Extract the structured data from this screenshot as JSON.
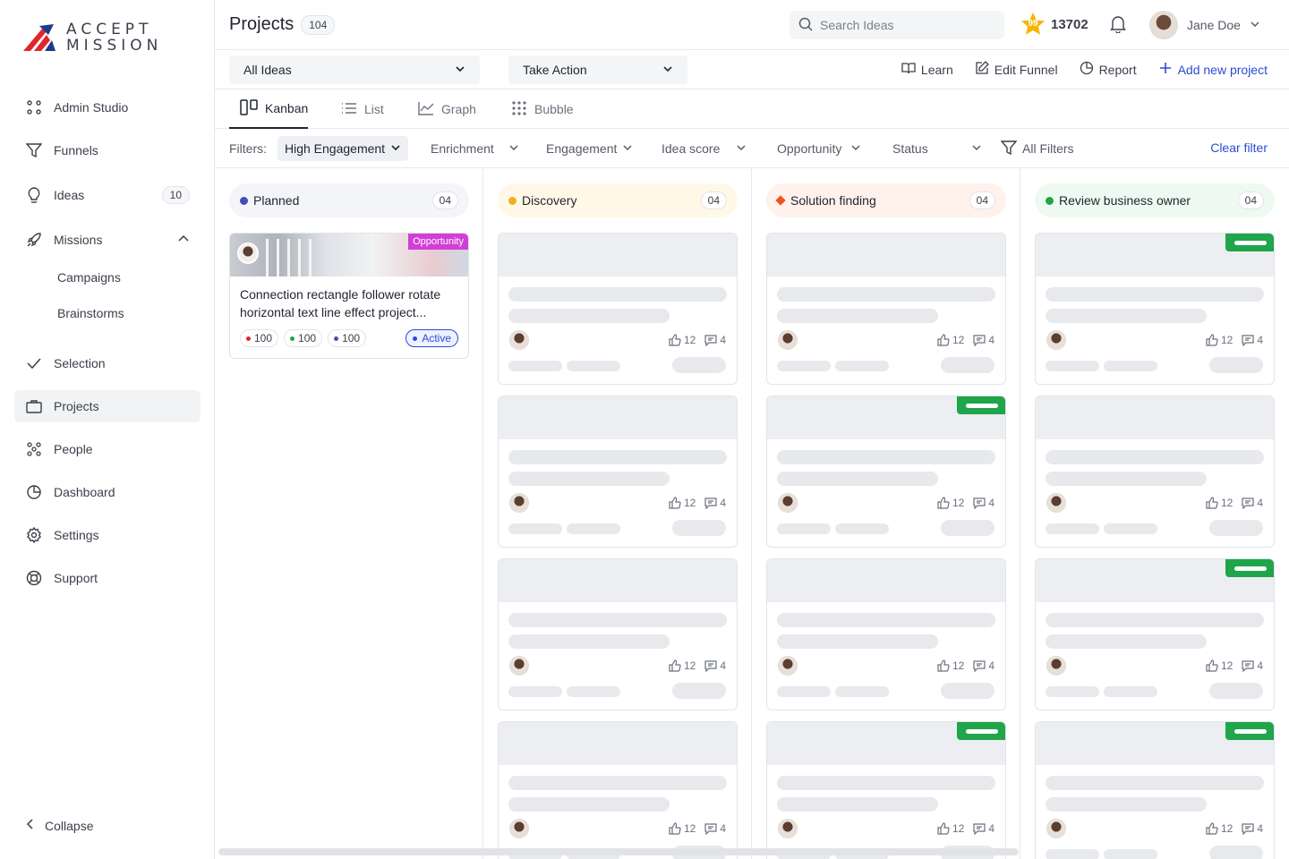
{
  "brand": {
    "line1": "ACCEPT",
    "line2": "MISSION",
    "logo_colors": [
      "#e0262d",
      "#1e3a8a"
    ]
  },
  "sidebar": {
    "items": [
      {
        "label": "Admin Studio",
        "icon": "grid-dots-icon"
      },
      {
        "label": "Funnels",
        "icon": "funnel-icon"
      },
      {
        "label": "Ideas",
        "icon": "lightbulb-icon",
        "count": "10"
      },
      {
        "label": "Missions",
        "icon": "rocket-icon"
      },
      {
        "label": "Selection",
        "icon": "check-icon"
      },
      {
        "label": "Projects",
        "icon": "briefcase-icon",
        "active": true
      },
      {
        "label": "People",
        "icon": "people-icon"
      },
      {
        "label": "Dashboard",
        "icon": "pie-chart-icon"
      },
      {
        "label": "Settings",
        "icon": "gear-icon"
      },
      {
        "label": "Support",
        "icon": "lifebuoy-icon"
      }
    ],
    "mission_sub": [
      "Campaigns",
      "Brainstorms"
    ],
    "collapse_label": "Collapse"
  },
  "header": {
    "title": "Projects",
    "count": "104",
    "search_placeholder": "Search Ideas",
    "points_badge": "99",
    "points": "13702",
    "user_name": "Jane Doe"
  },
  "actions": {
    "filter_select": "All Ideas",
    "action_select": "Take Action",
    "learn": "Learn",
    "edit_funnel": "Edit Funnel",
    "report": "Report",
    "add_project": "Add new project"
  },
  "views": {
    "kanban": "Kanban",
    "list": "List",
    "graph": "Graph",
    "bubble": "Bubble"
  },
  "filters": {
    "label": "Filters:",
    "active": "High Engagement",
    "enrichment": "Enrichment",
    "engagement": "Engagement",
    "idea_score": "Idea score",
    "opportunity": "Opportunity",
    "status": "Status",
    "all_filters": "All Filters",
    "clear": "Clear filter"
  },
  "columns": [
    {
      "name": "Planned",
      "count": "04",
      "dot": "#3f51b5",
      "bg": "#f4f5f8"
    },
    {
      "name": "Discovery",
      "count": "04",
      "dot": "#f2b01e",
      "bg": "#fff8e6"
    },
    {
      "name": "Solution finding",
      "count": "04",
      "dot": "#f0541e",
      "bg": "#fff1eb"
    },
    {
      "name": "Review business owner",
      "count": "04",
      "dot": "#1fa54a",
      "bg": "#eefaf1"
    }
  ],
  "project_card": {
    "tag": "Opportunity",
    "title": "Connection rectangle follower rotate horizontal text line effect project...",
    "metrics": [
      {
        "value": "100",
        "color": "#e0262d"
      },
      {
        "value": "100",
        "color": "#1fa54a"
      },
      {
        "value": "100",
        "color": "#3f51b5"
      }
    ],
    "status": "Active"
  },
  "card_stats": {
    "likes": "12",
    "comments": "4"
  }
}
